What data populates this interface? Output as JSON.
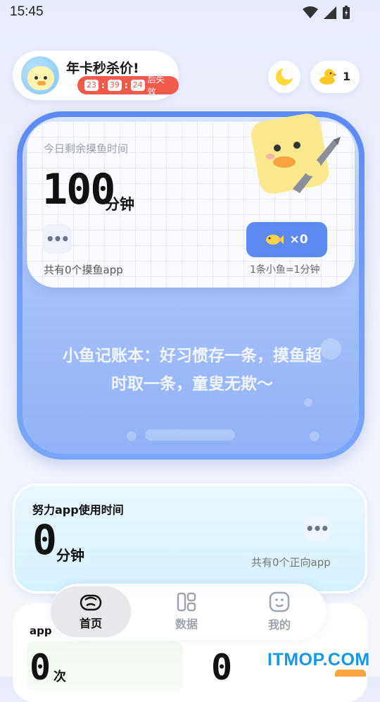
{
  "status_bar": {
    "time": "15:45"
  },
  "promo": {
    "title": "年卡秒杀价!",
    "countdown": {
      "hours": "23",
      "minutes": "39",
      "seconds": "24",
      "suffix": "后失效"
    }
  },
  "header": {
    "coin_count": "1"
  },
  "main_card": {
    "remain_label": "今日剩余摸鱼时间",
    "remain_value": "100",
    "remain_unit": "分钟",
    "total_apps": "共有0个摸鱼app",
    "fish_count": "×0",
    "fish_rate": "1条小鱼=1分钟",
    "slogan": "小鱼记账本：好习惯存一条，摸鱼超时取一条，童叟无欺～"
  },
  "effort_card": {
    "title": "努力app使用时间",
    "value": "0",
    "unit": "分钟",
    "total_apps": "共有0个正向app"
  },
  "bottom_card": {
    "label": "app",
    "left_value": "0",
    "left_unit": "次",
    "right_value": "0"
  },
  "tabs": [
    {
      "label": "首页",
      "active": true
    },
    {
      "label": "数据",
      "active": false
    },
    {
      "label": "我的",
      "active": false
    }
  ],
  "watermark": "ITMOP.COM",
  "colors": {
    "primary": "#5d8af0",
    "countdown_bg": "#f25a4b",
    "watermark": "#1598e8"
  }
}
